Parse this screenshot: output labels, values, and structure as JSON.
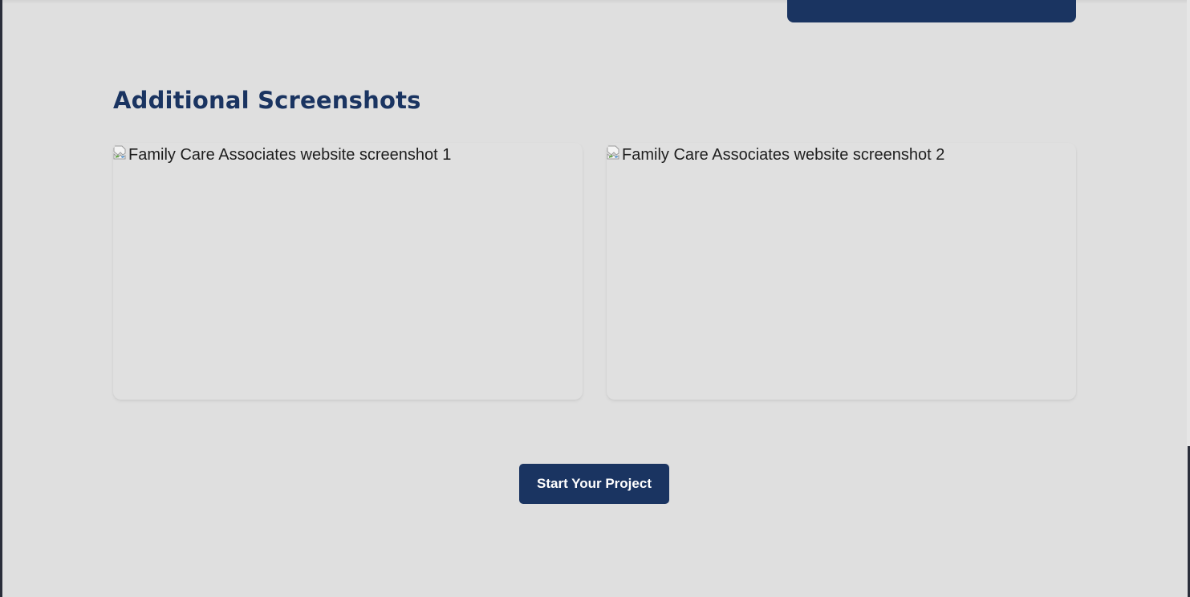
{
  "section": {
    "title": "Additional Screenshots"
  },
  "screenshots": [
    {
      "alt": "Family Care Associates website screenshot 1",
      "icon": "broken-image-icon"
    },
    {
      "alt": "Family Care Associates website screenshot 2",
      "icon": "broken-image-icon"
    }
  ],
  "cta": {
    "label": "Start Your Project"
  },
  "colors": {
    "background": "#dfdfdf",
    "brand_navy": "#1a3461",
    "button_text": "#ffffff",
    "alt_text": "#1e1e1e"
  }
}
